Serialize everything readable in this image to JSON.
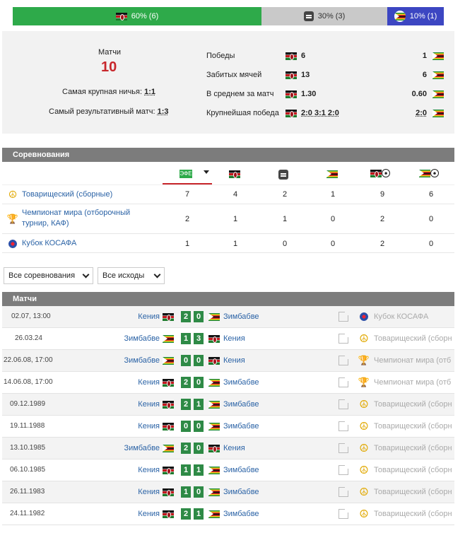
{
  "summary_bar": {
    "wins": "60% (6)",
    "draws": "30% (3)",
    "losses": "10% (1)"
  },
  "stats": {
    "matches_label": "Матчи",
    "matches_count": "10",
    "biggest_draw_label": "Самая крупная ничья:",
    "biggest_draw_value": "1:1",
    "most_goals_label": "Самый результативный матч:",
    "most_goals_value": "1:3",
    "rows": [
      {
        "label": "Победы",
        "home": "6",
        "away": "1"
      },
      {
        "label": "Забитых мячей",
        "home": "13",
        "away": "6"
      },
      {
        "label": "В среднем за матч",
        "home": "1.30",
        "away": "0.60"
      },
      {
        "label": "Крупнейшая победа",
        "home": "2:0 3:1 2:0",
        "away": "2:0"
      }
    ]
  },
  "competitions": {
    "header": "Соревнования",
    "rows": [
      {
        "name": "Товарищеский (сборные)",
        "icon": "peace-icon",
        "total": "7",
        "ke": "4",
        "draw": "2",
        "zw": "1",
        "ke_goals": "9",
        "zw_goals": "6"
      },
      {
        "name": "Чемпионат мира (отборочный турнир, КАФ)",
        "icon": "trophy-icon",
        "total": "2",
        "ke": "1",
        "draw": "1",
        "zw": "0",
        "ke_goals": "2",
        "zw_goals": "0"
      },
      {
        "name": "Кубок КОСАФА",
        "icon": "cosafa-icon",
        "total": "1",
        "ke": "1",
        "draw": "0",
        "zw": "0",
        "ke_goals": "2",
        "zw_goals": "0"
      }
    ]
  },
  "filters": {
    "competitions": "Все соревнования",
    "outcomes": "Все исходы"
  },
  "matches": {
    "header": "Матчи",
    "rows": [
      {
        "date": "02.07, 13:00",
        "home": "Кения",
        "home_flag": "ke",
        "hs": "2",
        "as": "0",
        "away": "Зимбабве",
        "away_flag": "zw",
        "comp": "Кубок КОСАФА",
        "icon": "cosafa-icon"
      },
      {
        "date": "26.03.24",
        "home": "Зимбабве",
        "home_flag": "zw",
        "hs": "1",
        "as": "3",
        "away": "Кения",
        "away_flag": "ke",
        "comp": "Товарищеский (сборн",
        "icon": "peace-icon"
      },
      {
        "date": "22.06.08, 17:00",
        "home": "Зимбабве",
        "home_flag": "zw",
        "hs": "0",
        "as": "0",
        "away": "Кения",
        "away_flag": "ke",
        "comp": "Чемпионат мира (отб",
        "icon": "trophy-icon"
      },
      {
        "date": "14.06.08, 17:00",
        "home": "Кения",
        "home_flag": "ke",
        "hs": "2",
        "as": "0",
        "away": "Зимбабве",
        "away_flag": "zw",
        "comp": "Чемпионат мира (отб",
        "icon": "trophy-icon"
      },
      {
        "date": "09.12.1989",
        "home": "Кения",
        "home_flag": "ke",
        "hs": "2",
        "as": "1",
        "away": "Зимбабве",
        "away_flag": "zw",
        "comp": "Товарищеский (сборн",
        "icon": "peace-icon"
      },
      {
        "date": "19.11.1988",
        "home": "Кения",
        "home_flag": "ke",
        "hs": "0",
        "as": "0",
        "away": "Зимбабве",
        "away_flag": "zw",
        "comp": "Товарищеский (сборн",
        "icon": "peace-icon"
      },
      {
        "date": "13.10.1985",
        "home": "Зимбабве",
        "home_flag": "zw",
        "hs": "2",
        "as": "0",
        "away": "Кения",
        "away_flag": "ke",
        "comp": "Товарищеский (сборн",
        "icon": "peace-icon"
      },
      {
        "date": "06.10.1985",
        "home": "Кения",
        "home_flag": "ke",
        "hs": "1",
        "as": "1",
        "away": "Зимбабве",
        "away_flag": "zw",
        "comp": "Товарищеский (сборн",
        "icon": "peace-icon"
      },
      {
        "date": "26.11.1983",
        "home": "Кения",
        "home_flag": "ke",
        "hs": "1",
        "as": "0",
        "away": "Зимбабве",
        "away_flag": "zw",
        "comp": "Товарищеский (сборн",
        "icon": "peace-icon"
      },
      {
        "date": "24.11.1982",
        "home": "Кения",
        "home_flag": "ke",
        "hs": "2",
        "as": "1",
        "away": "Зимбабве",
        "away_flag": "zw",
        "comp": "Товарищеский (сборн",
        "icon": "peace-icon"
      }
    ]
  },
  "colors": {
    "win": "#2eaa4a",
    "draw": "#c9c9c9",
    "loss": "#3c46c2",
    "accent_red": "#c8262b",
    "link": "#2b63a6",
    "score_box": "#2e8a46"
  }
}
